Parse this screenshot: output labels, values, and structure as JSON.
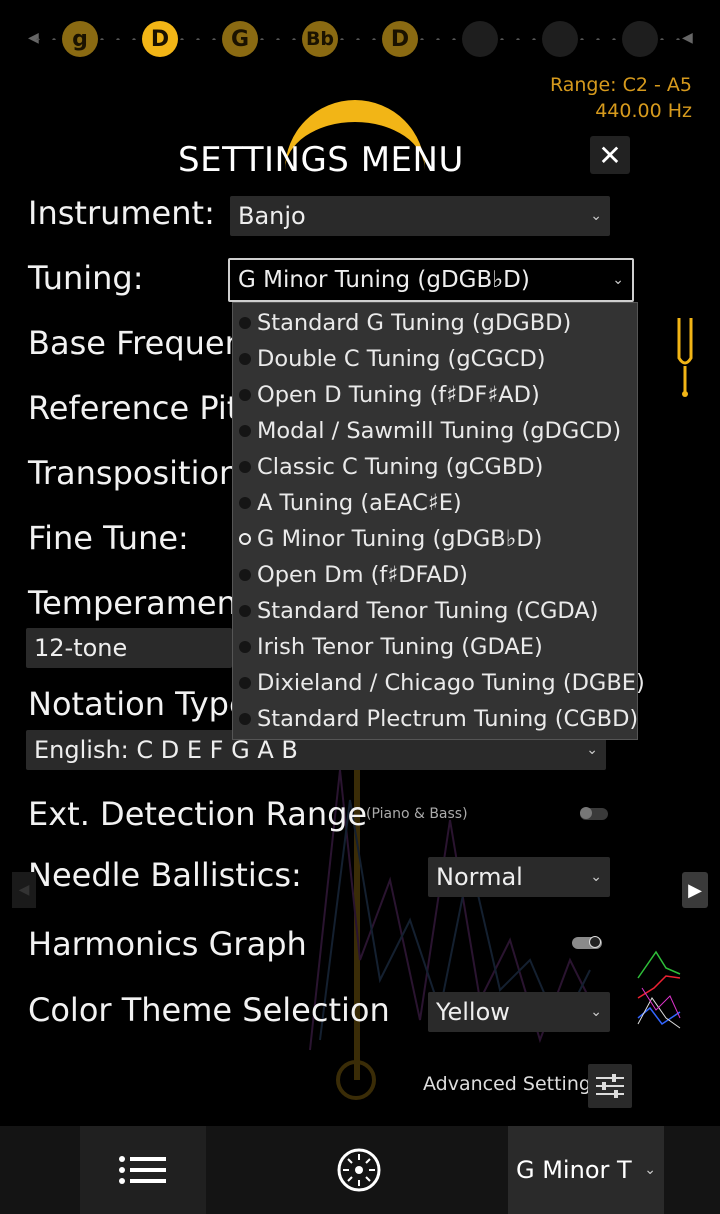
{
  "string_notes": [
    {
      "label": "g",
      "state": "dim"
    },
    {
      "label": "D",
      "state": "active"
    },
    {
      "label": "G",
      "state": "dim"
    },
    {
      "label": "Bb",
      "state": "dim"
    },
    {
      "label": "D",
      "state": "dim"
    },
    {
      "label": "",
      "state": "empty"
    },
    {
      "label": "",
      "state": "empty"
    },
    {
      "label": "",
      "state": "empty"
    }
  ],
  "range": {
    "line1": "Range: C2 - A5",
    "line2": "440.00 Hz"
  },
  "colors": {
    "accent": "#f2b516",
    "range_text": "#d69a1d",
    "background": "#000000"
  },
  "settings": {
    "title": "SETTINGS MENU",
    "close_icon": "close-icon",
    "instrument": {
      "label": "Instrument:",
      "value": "Banjo"
    },
    "tuning": {
      "label": "Tuning:",
      "value": "G Minor Tuning (gDGB♭D)"
    },
    "base_frequency": {
      "label": "Base Frequen"
    },
    "reference_pitch": {
      "label": "Reference Pitc"
    },
    "transposition": {
      "label": "Transposition"
    },
    "fine_tune": {
      "label": "Fine Tune:"
    },
    "temperament": {
      "label": "Temperament",
      "value": "12-tone"
    },
    "notation_type": {
      "label": "Notation Type",
      "value": "English: C D E F G A B"
    },
    "ext_detection": {
      "label": "Ext. Detection Range",
      "note": "(Piano & Bass)",
      "on": false
    },
    "needle_ballistics": {
      "label": "Needle Ballistics:",
      "value": "Normal"
    },
    "harmonics_graph": {
      "label": "Harmonics Graph",
      "on": true
    },
    "color_theme": {
      "label": "Color Theme Selection",
      "value": "Yellow"
    },
    "advanced": {
      "label": "Advanced Settings"
    }
  },
  "tuning_options": [
    {
      "label": "Standard G Tuning (gDGBD)",
      "selected": false
    },
    {
      "label": "Double C Tuning (gCGCD)",
      "selected": false
    },
    {
      "label": "Open D Tuning (f♯DF♯AD)",
      "selected": false
    },
    {
      "label": "Modal / Sawmill Tuning (gDGCD)",
      "selected": false
    },
    {
      "label": "Classic C Tuning (gCGBD)",
      "selected": false
    },
    {
      "label": "A Tuning (aEAC♯E)",
      "selected": false
    },
    {
      "label": "G Minor Tuning (gDGB♭D)",
      "selected": true
    },
    {
      "label": "Open Dm (f♯DFAD)",
      "selected": false
    },
    {
      "label": "Standard Tenor Tuning (CGDA)",
      "selected": false
    },
    {
      "label": "Irish Tenor Tuning (GDAE)",
      "selected": false
    },
    {
      "label": "Dixieland / Chicago Tuning (DGBE)",
      "selected": false
    },
    {
      "label": "Standard Plectrum Tuning (CGBD)",
      "selected": false
    }
  ],
  "bottom_bar": {
    "menu_icon": "list-menu-icon",
    "wheel_icon": "tuner-wheel-icon",
    "tuning_value": "G Minor T"
  }
}
